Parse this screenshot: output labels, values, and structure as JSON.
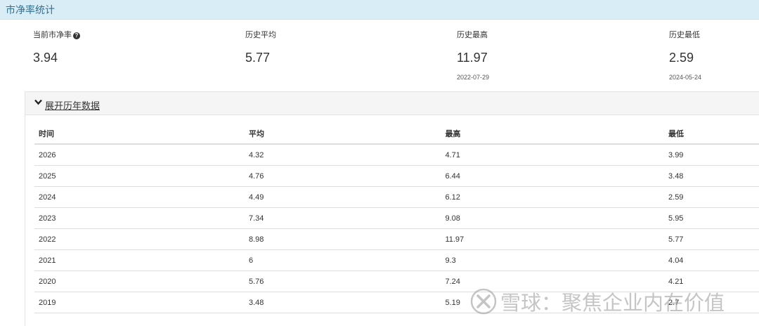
{
  "panel": {
    "title": "市净率统计"
  },
  "stats": [
    {
      "label": "当前市净率",
      "value": "3.94",
      "date": "",
      "has_help": true
    },
    {
      "label": "历史平均",
      "value": "5.77",
      "date": ""
    },
    {
      "label": "历史最高",
      "value": "11.97",
      "date": "2022-07-29"
    },
    {
      "label": "历史最低",
      "value": "2.59",
      "date": "2024-05-24"
    }
  ],
  "toggle": {
    "label": "展开历年数据",
    "icon": "chevron-down-icon"
  },
  "table": {
    "headers": [
      "时间",
      "平均",
      "最高",
      "最低"
    ],
    "rows": [
      [
        "2026",
        "4.32",
        "4.71",
        "3.99"
      ],
      [
        "2025",
        "4.76",
        "6.44",
        "3.48"
      ],
      [
        "2024",
        "4.49",
        "6.12",
        "2.59"
      ],
      [
        "2023",
        "7.34",
        "9.08",
        "5.95"
      ],
      [
        "2022",
        "8.98",
        "11.97",
        "5.77"
      ],
      [
        "2021",
        "6",
        "9.3",
        "4.04"
      ],
      [
        "2020",
        "5.76",
        "7.24",
        "4.21"
      ],
      [
        "2019",
        "3.48",
        "5.19",
        "2.7"
      ]
    ]
  },
  "watermark": {
    "text": "雪球：聚焦企业内在价值"
  }
}
